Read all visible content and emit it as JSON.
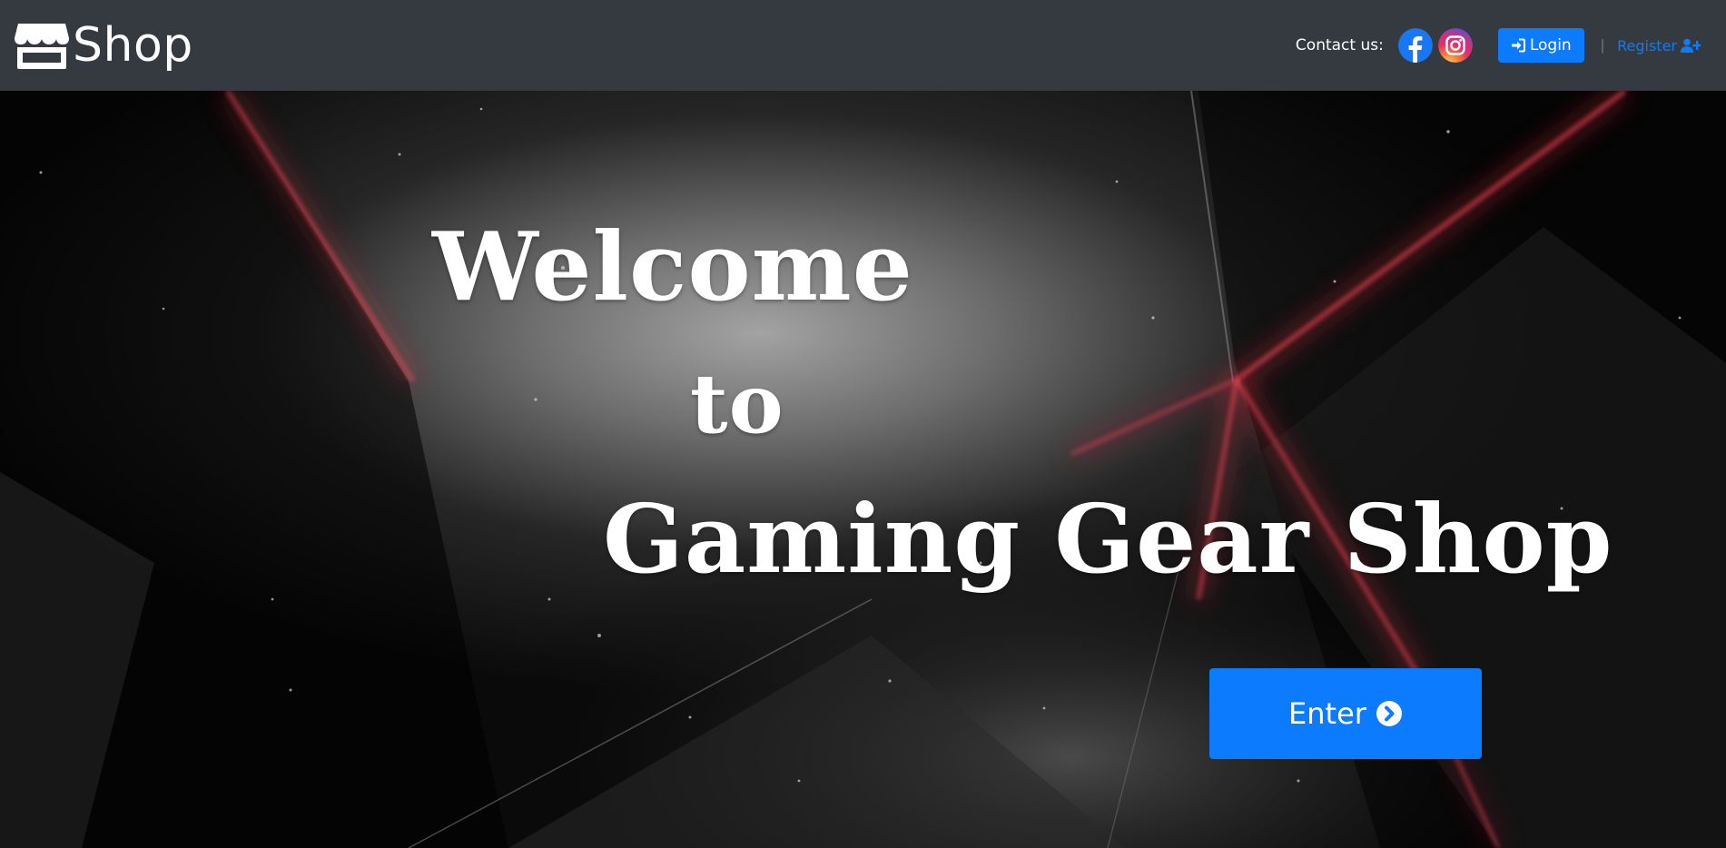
{
  "header": {
    "brand": {
      "text": "Shop",
      "icon": "storefront-icon"
    },
    "contact_label": "Contact us:",
    "social": [
      {
        "name": "facebook",
        "icon": "facebook-icon",
        "color": "#1877f2"
      },
      {
        "name": "instagram",
        "icon": "instagram-icon"
      }
    ],
    "login_label": "Login",
    "login_icon": "sign-in-icon",
    "separator": "|",
    "register_label": "Register",
    "register_icon": "user-plus-icon"
  },
  "hero": {
    "line1": "Welcome",
    "line2": "to",
    "line3": "Gaming Gear Shop",
    "enter_label": "Enter",
    "enter_icon": "chevron-circle-right-icon"
  },
  "colors": {
    "navbar": "#343a40",
    "accent": "#0d7bfd",
    "text": "#ffffff",
    "glow": "#e0263a"
  }
}
